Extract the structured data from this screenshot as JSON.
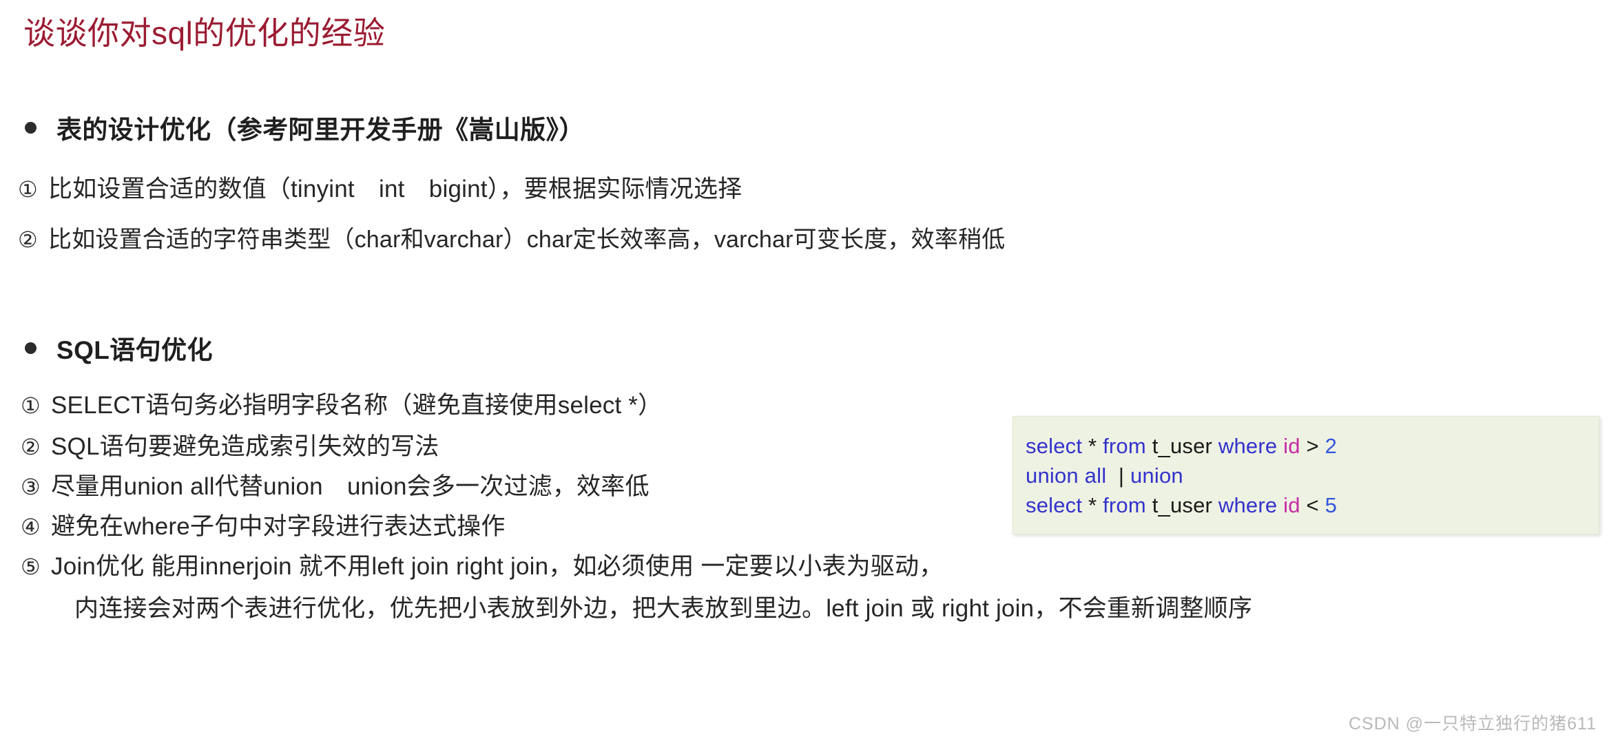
{
  "title": "谈谈你对sql的优化的经验",
  "accent_color": "#9b1b32",
  "sections": [
    {
      "heading": "表的设计优化（参考阿里开发手册《嵩山版》）",
      "items": [
        {
          "marker": "①",
          "text": "比如设置合适的数值（tinyint　int　bigint），要根据实际情况选择"
        },
        {
          "marker": "②",
          "text": "比如设置合适的字符串类型（char和varchar）char定长效率高，varchar可变长度，效率稍低"
        }
      ]
    },
    {
      "heading": "SQL语句优化",
      "items": [
        {
          "marker": "①",
          "text": "SELECT语句务必指明字段名称（避免直接使用select *）"
        },
        {
          "marker": "②",
          "text": "SQL语句要避免造成索引失效的写法"
        },
        {
          "marker": "③",
          "text": "尽量用union all代替union　union会多一次过滤，效率低"
        },
        {
          "marker": "④",
          "text": "避免在where子句中对字段进行表达式操作"
        },
        {
          "marker": "⑤",
          "text": "Join优化 能用innerjoin 就不用left join right join，如必须使用 一定要以小表为驱动，"
        }
      ],
      "continuation": "内连接会对两个表进行优化，优先把小表放到外边，把大表放到里边。left join 或 right join，不会重新调整顺序"
    }
  ],
  "code_box": {
    "background": "#eef2e2",
    "keyword_color": "#3333cc",
    "column_color": "#c42ba6",
    "number_color": "#3355dd",
    "lines": [
      {
        "tokens": [
          {
            "text": "select ",
            "type": "keyword"
          },
          {
            "text": "* ",
            "type": "plain"
          },
          {
            "text": "from ",
            "type": "keyword"
          },
          {
            "text": "t_user ",
            "type": "plain"
          },
          {
            "text": "where ",
            "type": "keyword"
          },
          {
            "text": "id ",
            "type": "column"
          },
          {
            "text": "> ",
            "type": "operator"
          },
          {
            "text": "2",
            "type": "number"
          }
        ]
      },
      {
        "tokens": [
          {
            "text": "union all ",
            "type": "keyword"
          },
          {
            "text": " | ",
            "type": "plain"
          },
          {
            "text": "union",
            "type": "keyword"
          }
        ]
      },
      {
        "tokens": [
          {
            "text": "select ",
            "type": "keyword"
          },
          {
            "text": "* ",
            "type": "plain"
          },
          {
            "text": "from ",
            "type": "keyword"
          },
          {
            "text": "t_user ",
            "type": "plain"
          },
          {
            "text": "where ",
            "type": "keyword"
          },
          {
            "text": "id ",
            "type": "column"
          },
          {
            "text": "< ",
            "type": "operator"
          },
          {
            "text": "5",
            "type": "number"
          }
        ]
      }
    ]
  },
  "watermark": "CSDN @一只特立独行的猪611"
}
